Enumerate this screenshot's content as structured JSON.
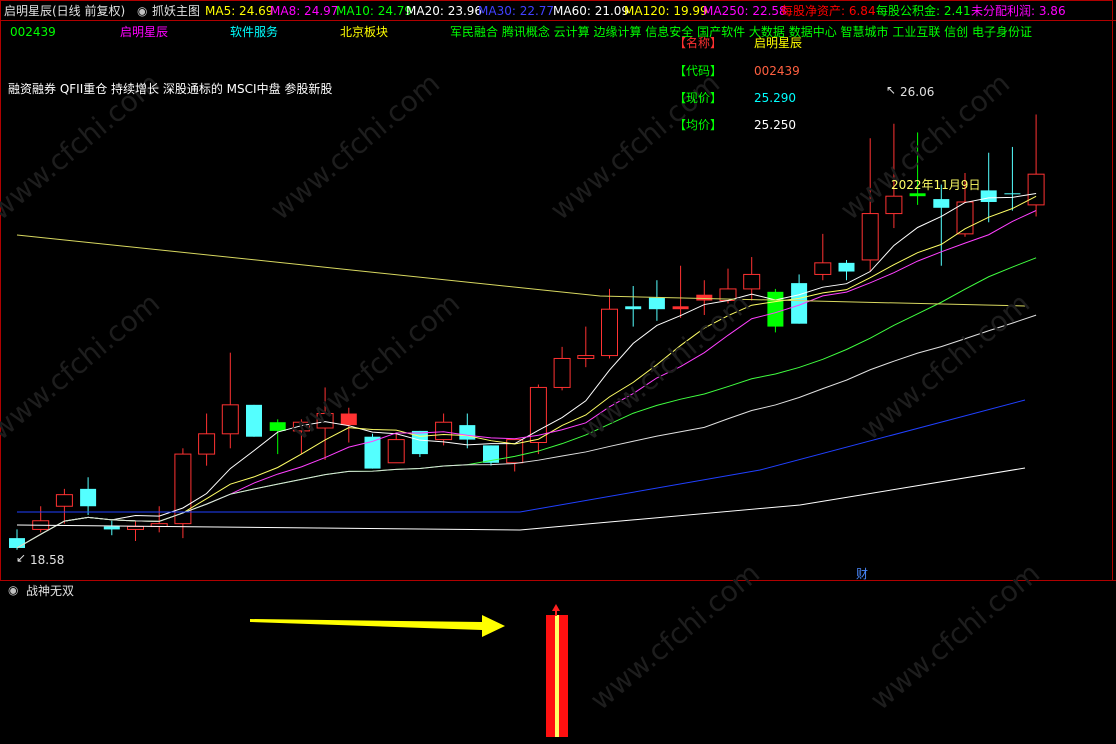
{
  "header": {
    "stock_title": "启明星辰(日线 前复权)",
    "indicator_name": "抓妖主图",
    "ma_values": [
      {
        "label": "MA5: 24.69",
        "color": "#ffff00"
      },
      {
        "label": "MA8: 24.97",
        "color": "#ff00ff"
      },
      {
        "label": "MA10: 24.79",
        "color": "#00ff00"
      },
      {
        "label": "MA20: 23.96",
        "color": "#ffffff"
      },
      {
        "label": "MA30: 22.77",
        "color": "#4040ff"
      },
      {
        "label": "MA60: 21.09",
        "color": "#ffffff"
      },
      {
        "label": "MA120: 19.99",
        "color": "#ffff00"
      },
      {
        "label": "MA250: 22.58",
        "color": "#ff00ff"
      },
      {
        "label": "每股净资产: 6.84",
        "color": "#ff0000"
      },
      {
        "label": "每股公积金: 2.41",
        "color": "#00ff00"
      },
      {
        "label": "未分配利润: 3.86",
        "color": "#ff00ff"
      }
    ]
  },
  "row2": {
    "code": "002439",
    "name": "启明星辰",
    "industry": "软件服务",
    "board": "北京板块",
    "concepts": "军民融合 腾讯概念 云计算 边缘计算 信息安全 国产软件 大数据 数据中心 智慧城市 工业互联 信创 电子身份证"
  },
  "concept_line2": "融资融券 QFII重仓 持续增长 深股通标的 MSCI中盘 参股新股",
  "info_panel": {
    "name_label": "【名称】",
    "name_value": "启明星辰",
    "code_label": "【代码】",
    "code_value": "002439",
    "price_label": "【现价】",
    "price_value": "25.290",
    "avg_label": "【均价】",
    "avg_value": "25.250"
  },
  "chart_annotations": {
    "high_label": "26.06",
    "low_label": "18.58",
    "date_label": "2022年11月9日",
    "finance_marker": "财"
  },
  "sub_panel": {
    "title": "战神无双"
  },
  "watermark": "www.cfchi.com",
  "colors": {
    "up": "#ff3232",
    "down_cyan": "#54ffff",
    "down_green": "#00ff00",
    "border": "#b00000"
  },
  "chart_data": {
    "type": "candlestick",
    "y_range": [
      18.2,
      27.0
    ],
    "candles": [
      {
        "o": 18.75,
        "c": 18.58,
        "h": 18.9,
        "l": 18.55
      },
      {
        "o": 18.9,
        "c": 19.05,
        "h": 19.3,
        "l": 18.85
      },
      {
        "o": 19.3,
        "c": 19.5,
        "h": 19.6,
        "l": 19.0
      },
      {
        "o": 19.6,
        "c": 19.3,
        "h": 19.8,
        "l": 19.15
      },
      {
        "o": 18.95,
        "c": 18.9,
        "h": 19.05,
        "l": 18.8
      },
      {
        "o": 18.9,
        "c": 18.95,
        "h": 19.05,
        "l": 18.7
      },
      {
        "o": 18.95,
        "c": 19.0,
        "h": 19.3,
        "l": 18.85
      },
      {
        "o": 19.0,
        "c": 20.2,
        "h": 20.3,
        "l": 18.75
      },
      {
        "o": 20.2,
        "c": 20.55,
        "h": 20.9,
        "l": 20.0
      },
      {
        "o": 20.55,
        "c": 21.05,
        "h": 21.95,
        "l": 20.3
      },
      {
        "o": 21.05,
        "c": 20.5,
        "h": 21.05,
        "l": 20.5
      },
      {
        "o": 20.75,
        "c": 20.6,
        "h": 20.8,
        "l": 20.2
      },
      {
        "o": 20.6,
        "c": 20.75,
        "h": 20.8,
        "l": 20.2
      },
      {
        "o": 20.65,
        "c": 20.9,
        "h": 21.35,
        "l": 20.1
      },
      {
        "o": 20.9,
        "c": 20.7,
        "h": 21.0,
        "l": 20.4
      },
      {
        "o": 20.5,
        "c": 19.95,
        "h": 20.55,
        "l": 19.95
      },
      {
        "o": 20.05,
        "c": 20.45,
        "h": 20.55,
        "l": 20.05
      },
      {
        "o": 20.6,
        "c": 20.2,
        "h": 20.6,
        "l": 20.15
      },
      {
        "o": 20.45,
        "c": 20.75,
        "h": 20.9,
        "l": 20.35
      },
      {
        "o": 20.7,
        "c": 20.45,
        "h": 20.9,
        "l": 20.3
      },
      {
        "o": 20.35,
        "c": 20.05,
        "h": 20.35,
        "l": 20.0
      },
      {
        "o": 20.05,
        "c": 20.45,
        "h": 20.45,
        "l": 19.9
      },
      {
        "o": 20.4,
        "c": 21.35,
        "h": 21.4,
        "l": 20.2
      },
      {
        "o": 21.35,
        "c": 21.85,
        "h": 22.05,
        "l": 21.3
      },
      {
        "o": 21.85,
        "c": 21.9,
        "h": 22.4,
        "l": 21.7
      },
      {
        "o": 21.9,
        "c": 22.7,
        "h": 23.05,
        "l": 21.85
      },
      {
        "o": 22.7,
        "c": 22.75,
        "h": 23.1,
        "l": 22.4
      },
      {
        "o": 22.7,
        "c": 22.9,
        "h": 23.2,
        "l": 22.5
      },
      {
        "o": 22.75,
        "c": 22.7,
        "h": 23.45,
        "l": 22.55
      },
      {
        "o": 22.95,
        "c": 22.85,
        "h": 23.2,
        "l": 22.6
      },
      {
        "o": 22.85,
        "c": 23.05,
        "h": 23.4,
        "l": 22.8
      },
      {
        "o": 23.05,
        "c": 23.3,
        "h": 23.6,
        "l": 22.85
      },
      {
        "o": 23.0,
        "c": 22.4,
        "h": 23.05,
        "l": 22.3
      },
      {
        "o": 22.45,
        "c": 23.15,
        "h": 23.3,
        "l": 22.45
      },
      {
        "o": 23.3,
        "c": 23.5,
        "h": 24.0,
        "l": 23.2
      },
      {
        "o": 23.5,
        "c": 23.35,
        "h": 23.55,
        "l": 23.2
      },
      {
        "o": 23.55,
        "c": 24.35,
        "h": 25.65,
        "l": 23.35
      },
      {
        "o": 24.35,
        "c": 24.65,
        "h": 25.9,
        "l": 24.1
      },
      {
        "o": 24.65,
        "c": 24.7,
        "h": 25.75,
        "l": 24.5
      },
      {
        "o": 24.6,
        "c": 24.45,
        "h": 24.85,
        "l": 23.45
      },
      {
        "o": 24.0,
        "c": 24.55,
        "h": 25.05,
        "l": 23.95
      },
      {
        "o": 24.55,
        "c": 24.75,
        "h": 25.4,
        "l": 24.2
      },
      {
        "o": 24.7,
        "c": 24.7,
        "h": 25.5,
        "l": 24.4
      },
      {
        "o": 24.5,
        "c": 25.03,
        "h": 26.06,
        "l": 24.3
      }
    ]
  }
}
